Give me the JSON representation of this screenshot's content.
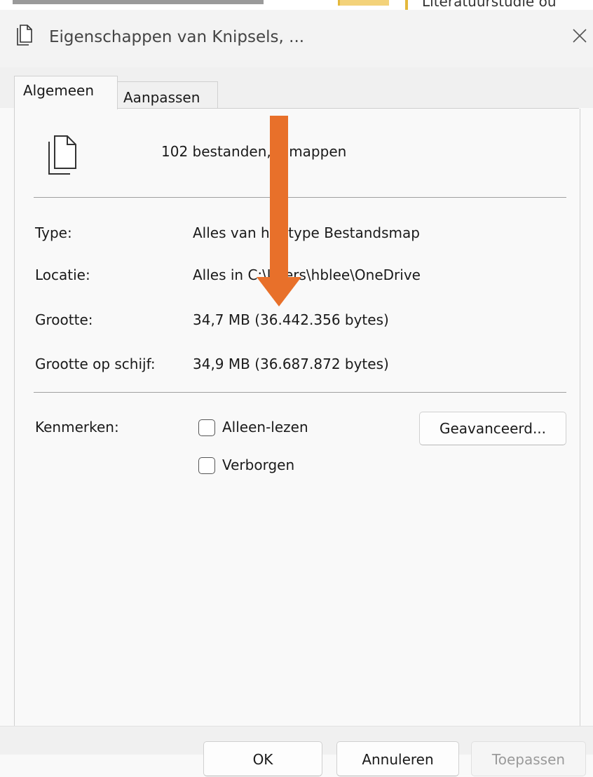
{
  "background": {
    "fragment_text": "Literatuurstudie ou"
  },
  "window": {
    "title": "Eigenschappen van Knipsels, ...",
    "icon": "files-icon",
    "close_icon": "close-icon"
  },
  "tabs": [
    {
      "label": "Algemeen",
      "active": true
    },
    {
      "label": "Aanpassen",
      "active": false
    }
  ],
  "general": {
    "summary": "102 bestanden, 4 mappen",
    "properties": [
      {
        "label": "Type:",
        "value": "Alles van het type Bestandsmap"
      },
      {
        "label": "Locatie:",
        "value": "Alles in C:\\Users\\hblee\\OneDrive"
      },
      {
        "label": "Grootte:",
        "value": "34,7 MB (36.442.356 bytes)"
      },
      {
        "label": "Grootte op schijf:",
        "value": "34,9 MB (36.687.872 bytes)"
      }
    ],
    "attributes_label": "Kenmerken:",
    "attributes": [
      {
        "label": "Alleen-lezen",
        "checked": false
      },
      {
        "label": "Verborgen",
        "checked": false
      }
    ],
    "advanced_button": "Geavanceerd..."
  },
  "footer": {
    "ok": "OK",
    "cancel": "Annuleren",
    "apply": "Toepassen"
  },
  "annotation": {
    "arrow_color": "#e8702a",
    "direction": "down"
  }
}
